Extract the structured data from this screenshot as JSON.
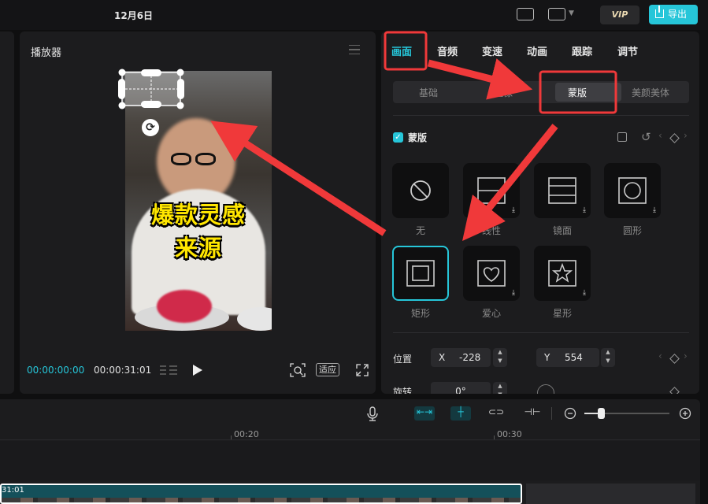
{
  "topbar": {
    "date": "12月6日",
    "vip": "VIP",
    "export": "导出"
  },
  "player": {
    "title": "播放器",
    "video_text_line1": "爆款灵感",
    "video_text_line2": "来源",
    "current_time": "00:00:00:00",
    "total_time": "00:00:31:01",
    "fit_label": "适应"
  },
  "right_panel": {
    "tabs": [
      "画面",
      "音频",
      "变速",
      "动画",
      "跟踪",
      "调节"
    ],
    "active_tab": "画面",
    "subtabs": [
      "基础",
      "抠像",
      "蒙版",
      "美颜美体"
    ],
    "active_subtab": "蒙版",
    "mask_section_label": "蒙版",
    "mask_options": [
      "无",
      "线性",
      "镜面",
      "圆形",
      "矩形",
      "爱心",
      "星形"
    ],
    "selected_mask": "矩形",
    "position_label": "位置",
    "pos_x_axis": "X",
    "pos_x": "-228",
    "pos_y_axis": "Y",
    "pos_y": "554",
    "rotation_label": "旋转",
    "rotation_value": "0°"
  },
  "timeline": {
    "ticks": [
      "00:20",
      "00:30"
    ],
    "clip_time": "31:01"
  },
  "colors": {
    "accent": "#26c6d9",
    "annotation": "#f0393a"
  }
}
